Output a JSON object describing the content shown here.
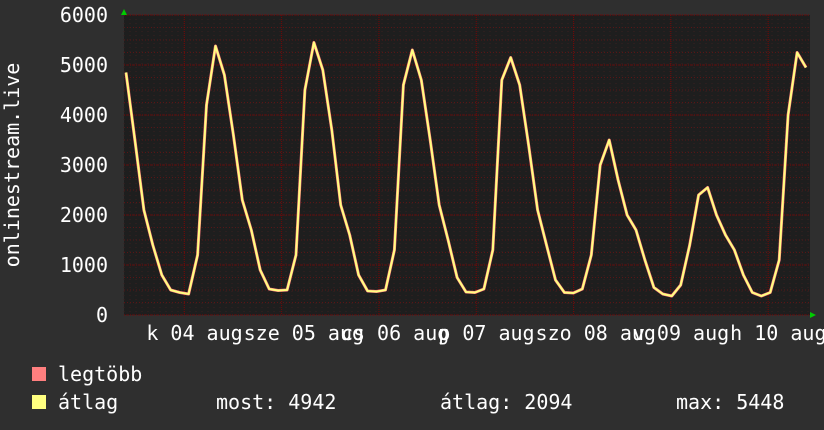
{
  "chart_data": {
    "type": "line",
    "ylabel": "onlinestream.live",
    "ylim": [
      0,
      6000
    ],
    "yticks": [
      0,
      1000,
      2000,
      3000,
      4000,
      5000,
      6000
    ],
    "x_tick_labels": [
      "k 04 aug",
      "sze 05 aug",
      "cs 06 aug",
      "p 07 aug",
      "szo 08 aug",
      "v 09 aug",
      "h 10 aug"
    ],
    "grid": true,
    "series": [
      {
        "name": "legtöbb",
        "color": "#ff7f7f",
        "values": [
          4850,
          3500,
          2100,
          1400,
          800,
          500,
          450,
          420,
          1200,
          4200,
          5380,
          4800,
          3600,
          2300,
          1700,
          900,
          520,
          490,
          500,
          1200,
          4500,
          5450,
          4900,
          3700,
          2200,
          1600,
          800,
          480,
          470,
          500,
          1300,
          4600,
          5300,
          4700,
          3500,
          2200,
          1500,
          750,
          460,
          450,
          520,
          1300,
          4700,
          5150,
          4600,
          3400,
          2100,
          1400,
          700,
          450,
          440,
          520,
          1200,
          3000,
          3500,
          2700,
          2000,
          1700,
          1100,
          550,
          420,
          380,
          600,
          1400,
          2400,
          2550,
          2000,
          1600,
          1300,
          800,
          450,
          380,
          450,
          1100,
          4000,
          5250,
          4950
        ]
      },
      {
        "name": "átlag",
        "color": "#ffff80",
        "values": [
          4850,
          3500,
          2100,
          1400,
          800,
          500,
          450,
          420,
          1200,
          4200,
          5380,
          4800,
          3600,
          2300,
          1700,
          900,
          520,
          490,
          500,
          1200,
          4500,
          5450,
          4900,
          3700,
          2200,
          1600,
          800,
          480,
          470,
          500,
          1300,
          4600,
          5300,
          4700,
          3500,
          2200,
          1500,
          750,
          460,
          450,
          520,
          1300,
          4700,
          5150,
          4600,
          3400,
          2100,
          1400,
          700,
          450,
          440,
          520,
          1200,
          3000,
          3500,
          2700,
          2000,
          1700,
          1100,
          550,
          420,
          380,
          600,
          1400,
          2400,
          2550,
          2000,
          1600,
          1300,
          800,
          450,
          380,
          450,
          1100,
          4000,
          5250,
          4950
        ]
      }
    ]
  },
  "legend": {
    "max_label": "legtöbb",
    "avg_label": "átlag"
  },
  "stats": {
    "now": "most: 4942",
    "avg": "átlag: 2094",
    "max": "max: 5448"
  },
  "colors": {
    "background": "#2f2f2f",
    "plot_background": "#1e1e1e",
    "grid": "#8b0000",
    "axis_arrow": "#00cc00"
  }
}
